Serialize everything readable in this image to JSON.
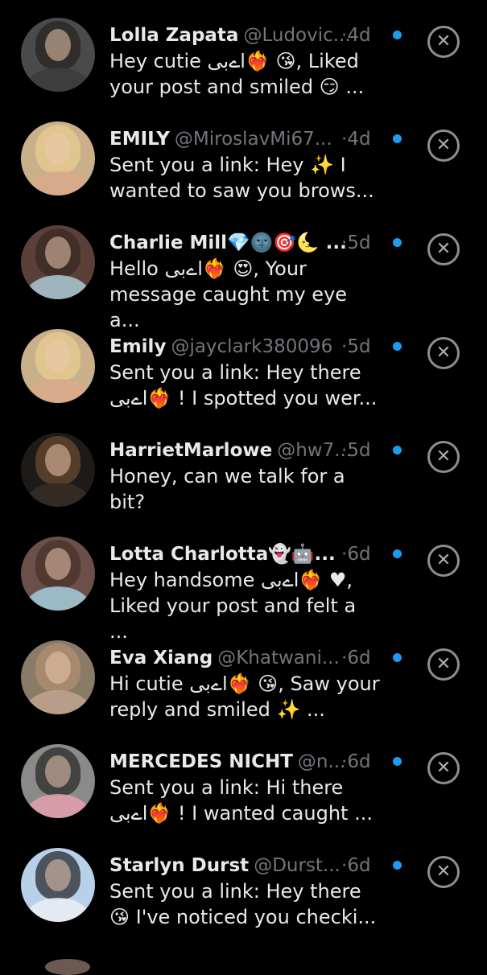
{
  "icons": {
    "dismiss": "close-circle-icon",
    "unread": "unread-dot-icon"
  },
  "colors": {
    "background": "#000000",
    "text": "#e7e9ea",
    "muted": "#71767b",
    "unread_dot": "#1d9bf0"
  },
  "messages": [
    {
      "name": "Lolla Zapata",
      "handle": "@Ludovic...",
      "separator": "·",
      "age": "4d",
      "preview": "Hey cutie اےبی❤️‍🔥 😘, Liked your post and smiled 😏 ...",
      "avatar": {
        "bg": "#4a4a4a",
        "hair": "#2a2420",
        "top": "#3a3a3a"
      }
    },
    {
      "name": "EMILY",
      "handle": "@MiroslavMi67...",
      "separator": "·",
      "age": "4d",
      "preview": "Sent you a link: Hey ✨ I wanted to saw you brows...",
      "avatar": {
        "bg": "#c9b08a",
        "hair": "#e6cc8f",
        "top": "#d9a98a"
      }
    },
    {
      "name": "Charlie Mill💎🌚🎯🌜 ...",
      "handle": "",
      "separator": "·",
      "age": "5d",
      "preview": "Hello اےبی❤️‍🔥 😍, Your message caught my eye a...",
      "avatar": {
        "bg": "#5a4038",
        "hair": "#3a2a22",
        "top": "#b0d2e0"
      }
    },
    {
      "name": "Emily",
      "handle": "@jayclark380096",
      "separator": "·",
      "age": "5d",
      "preview": "Sent you a link: Hey there اےبی❤️‍🔥 ! I spotted you wer...",
      "avatar": {
        "bg": "#c9b08a",
        "hair": "#e6cc8f",
        "top": "#d9a98a"
      }
    },
    {
      "name": "HarrietMarlowe",
      "handle": "@hw7...",
      "separator": "·",
      "age": "5d",
      "preview": "Honey, can we talk for a bit?",
      "avatar": {
        "bg": "#1e1a18",
        "hair": "#6a4a30",
        "top": "#3a2e28"
      }
    },
    {
      "name": "Lotta Charlotta👻🤖...",
      "handle": "",
      "separator": "·",
      "age": "6d",
      "preview": "Hey handsome اےبی❤️‍🔥 ♥, Liked your post and felt a ...",
      "avatar": {
        "bg": "#6a5048",
        "hair": "#4a3028",
        "top": "#a8d4e6"
      }
    },
    {
      "name": "Eva Xiang",
      "handle": "@Khatwani...",
      "separator": "·",
      "age": "6d",
      "preview": "Hi cutie اےبی❤️‍🔥 😘, Saw your reply and smiled ✨ ...",
      "avatar": {
        "bg": "#8a7a68",
        "hair": "#b09070",
        "top": "#c0a890"
      }
    },
    {
      "name": "MERCEDES NICHT",
      "handle": "@n...",
      "separator": "·",
      "age": "6d",
      "preview": "Sent you a link: Hi there اےبی❤️‍🔥 ! I wanted caught ...",
      "avatar": {
        "bg": "#8a8a88",
        "hair": "#2a2a2a",
        "top": "#e8a0b0"
      }
    },
    {
      "name": "Starlyn Durst",
      "handle": "@Durst...",
      "separator": "·",
      "age": "6d",
      "preview": "Sent you a link: Hey there 😘 I've noticed you checki...",
      "avatar": {
        "bg": "#b8d0e8",
        "hair": "#2a2a30",
        "top": "#f0f0f4"
      }
    }
  ]
}
